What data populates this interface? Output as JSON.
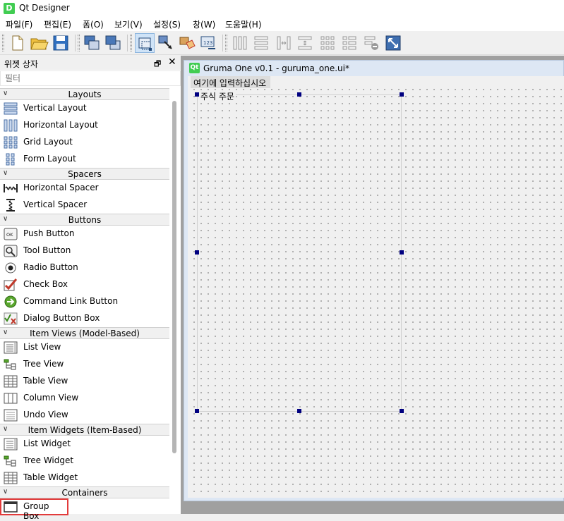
{
  "app": {
    "title": "Qt Designer",
    "icon": "D"
  },
  "menubar": {
    "items": [
      "파일(F)",
      "편집(E)",
      "폼(O)",
      "보기(V)",
      "설정(S)",
      "창(W)",
      "도움말(H)"
    ]
  },
  "toolbar": {
    "buttons": [
      {
        "name": "new-file-icon"
      },
      {
        "name": "open-folder-icon"
      },
      {
        "name": "save-icon"
      },
      {
        "name": "send-to-back-icon"
      },
      {
        "name": "bring-to-front-icon"
      },
      {
        "name": "edit-widgets-icon"
      },
      {
        "name": "edit-signals-slots-icon"
      },
      {
        "name": "edit-buddies-icon"
      },
      {
        "name": "edit-tab-order-icon"
      },
      {
        "name": "layout-horizontal-icon"
      },
      {
        "name": "layout-vertical-icon"
      },
      {
        "name": "layout-h-splitter-icon"
      },
      {
        "name": "layout-v-splitter-icon"
      },
      {
        "name": "layout-grid-icon"
      },
      {
        "name": "layout-form-icon"
      },
      {
        "name": "break-layout-icon"
      },
      {
        "name": "adjust-size-icon"
      }
    ]
  },
  "widget_box": {
    "title": "위젯 상자",
    "float_icon": "🗗",
    "close_icon": "✕",
    "filter_placeholder": "필터",
    "categories": [
      {
        "label": "Layouts",
        "items": [
          "Vertical Layout",
          "Horizontal Layout",
          "Grid Layout",
          "Form Layout"
        ]
      },
      {
        "label": "Spacers",
        "items": [
          "Horizontal Spacer",
          "Vertical Spacer"
        ]
      },
      {
        "label": "Buttons",
        "items": [
          "Push Button",
          "Tool Button",
          "Radio Button",
          "Check Box",
          "Command Link Button",
          "Dialog Button Box"
        ]
      },
      {
        "label": "Item Views (Model-Based)",
        "items": [
          "List View",
          "Tree View",
          "Table View",
          "Column View",
          "Undo View"
        ]
      },
      {
        "label": "Item Widgets (Item-Based)",
        "items": [
          "List Widget",
          "Tree Widget",
          "Table Widget"
        ]
      },
      {
        "label": "Containers",
        "items": [
          "Group Box"
        ]
      }
    ],
    "selected_item": "Group Box"
  },
  "form": {
    "qt_icon": "Qt",
    "title": "Gruma One v0.1 - guruma_one.ui*",
    "menu_placeholder": "여기에 입력하십시오",
    "groupbox_title": "주식 주문"
  },
  "colors": {
    "selection_handle": "#000080",
    "selected_outline": "#e23b3b",
    "qt_green": "#41cd52"
  }
}
